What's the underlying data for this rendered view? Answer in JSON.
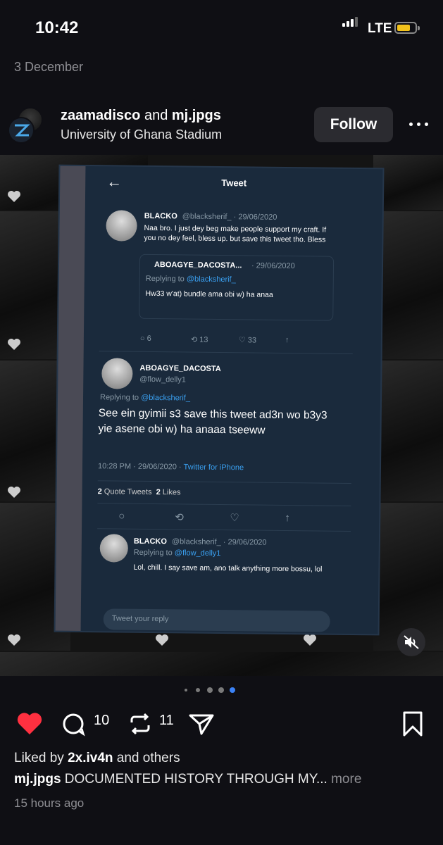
{
  "status_bar": {
    "time": "10:42",
    "network": "LTE",
    "battery_color": "#f2c21b"
  },
  "post_date": "3 December",
  "header": {
    "user1": "zaamadisco",
    "connector": "and",
    "user2": "mj.jpgs",
    "location": "University of Ghana Stadium",
    "follow_label": "Follow"
  },
  "tweet": {
    "title": "Tweet",
    "main": {
      "name": "BLACKO",
      "meta": "@blacksherif_ · 29/06/2020",
      "text": "Naa bro. I just dey beg make people support my craft. If you no dey feel, bless up. but save this tweet tho. Bless"
    },
    "quoted": {
      "name": "ABOAGYE_DACOSTA...",
      "meta": "· 29/06/2020",
      "replying_prefix": "Replying to",
      "replying_handle": "@blacksherif_",
      "text": "Hw33 w'at) bundle ama obi w) ha anaa"
    },
    "main_stats": {
      "replies": "6",
      "retweets": "13",
      "likes": "33"
    },
    "focus": {
      "name": "ABOAGYE_DACOSTA",
      "handle": "@flow_delly1",
      "replying_prefix": "Replying to",
      "replying_handle": "@blacksherif_",
      "text": "See ein gyimii s3 save this tweet ad3n wo b3y3 yie asene obi w) ha anaaa tseeww",
      "timestamp": "10:28 PM · 29/06/2020 ·",
      "source": "Twitter for iPhone",
      "quote_count": "2",
      "quote_label": "Quote Tweets",
      "likes_count": "2",
      "likes_label": "Likes"
    },
    "reply": {
      "name": "BLACKO",
      "meta": "@blacksherif_ · 29/06/2020",
      "replying_prefix": "Replying to",
      "replying_handle": "@flow_delly1",
      "text": "Lol, chill. I say save am, ano talk anything more bossu, lol"
    },
    "reply_placeholder": "Tweet your reply"
  },
  "carousel": {
    "total": 5,
    "active_index": 4,
    "active_color": "#3b82f6"
  },
  "actions": {
    "like_color": "#ff3040",
    "comments": "10",
    "reposts": "11"
  },
  "liked_by": {
    "prefix": "Liked by",
    "user": "2x.iv4n",
    "suffix": "and others"
  },
  "caption": {
    "user": "mj.jpgs",
    "text": "DOCUMENTED HISTORY THROUGH MY...",
    "more": "more"
  },
  "time_ago": "15 hours ago"
}
